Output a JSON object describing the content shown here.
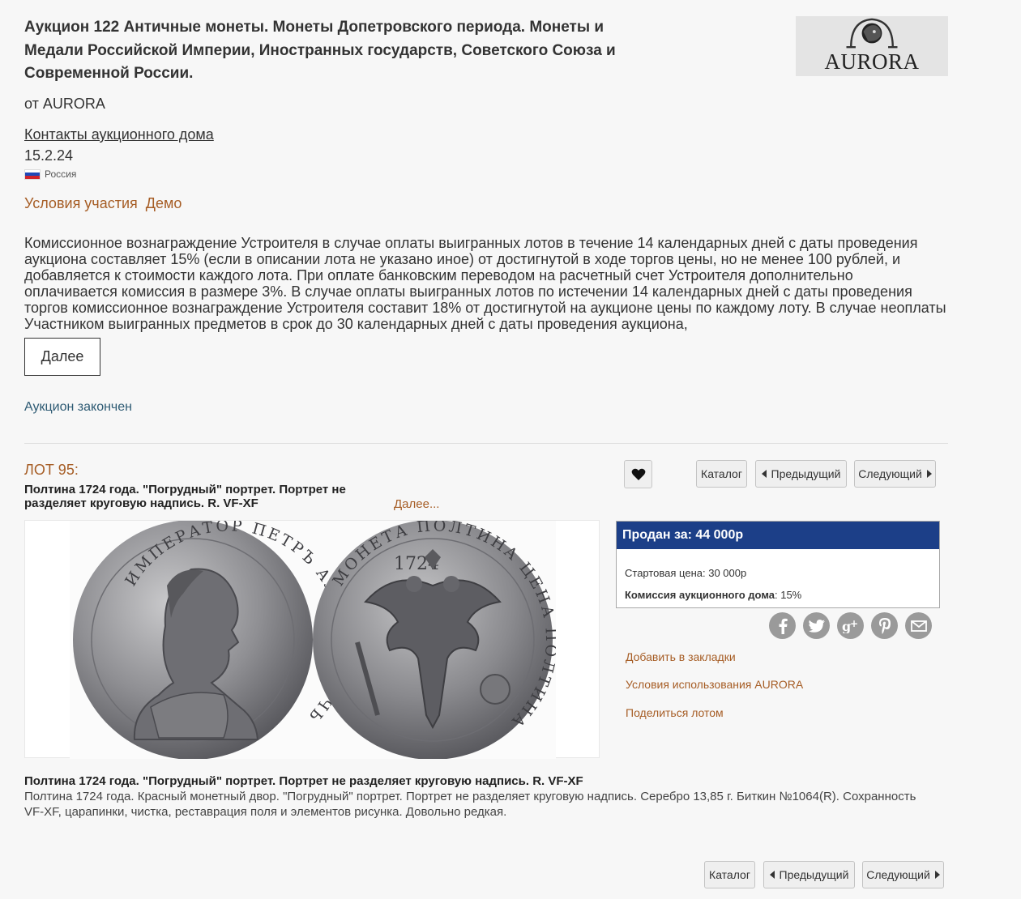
{
  "header": {
    "title": "Аукцион 122 Античные монеты. Монеты Допетровского периода. Монеты и Медали Российской Империи, Иностранных государств, Советского Союза и Современной России.",
    "from": "от AURORA",
    "contacts_link": "Контакты аукционного дома",
    "date": "15.2.24",
    "country": "Россия",
    "logo_text": "AURORA",
    "terms_link": "Условия участия",
    "demo_link": "Демо"
  },
  "terms": {
    "text": "Комиссионное вознаграждение Устроителя в случае оплаты выигранных лотов в течение 14 календарных дней с даты проведения аукциона составляет 15% (если в описании лота не указано иное) от достигнутой в ходе торгов цены, но не менее 100 рублей, и добавляется к стоимости каждого лота. При оплате банковским переводом на расчетный счет Устроителя дополнительно оплачивается комиссия в размере 3%. В случае оплаты выигранных лотов по истечении 14 календарных дней с даты проведения торгов комиссионное вознаграждение Устроителя составит 18% от достигнутой на аукционе цены по каждому лоту. В случае неоплаты Участником выигранных предметов в срок до 30 календарных дней с даты проведения аукциона,",
    "more_button": "Далее",
    "status": "Аукцион закончен"
  },
  "lot": {
    "number": "ЛОТ 95:",
    "short_title": "Полтина 1724 года. \"Погрудный\" портрет. Портрет не разделяет круговую надпись. R. VF-XF",
    "more_link": "Далее...",
    "nav": {
      "catalog": "Каталог",
      "prev": "Предыдущий",
      "next": "Следующий"
    },
    "sold_label": "Продан за: 44 000р",
    "start_price_label": "Стартовая цена:",
    "start_price_value": "30 000р",
    "commission_label": "Комиссия аукционного дома",
    "commission_value": ": 15%",
    "side_links": {
      "bookmark": "Добавить в закладки",
      "terms": "Условия использования AURORA",
      "share": "Поделиться лотом"
    },
    "social_icons": [
      "facebook-icon",
      "twitter-icon",
      "google-plus-icon",
      "pinterest-icon",
      "mail-icon"
    ],
    "description_title": "Полтина 1724 года. \"Погрудный\" портрет. Портрет не разделяет круговую надпись. R. VF-XF",
    "description_body": "Полтина 1724 года. Красный монетный двор. \"Погрудный\" портрет. Портрет не разделяет круговую надпись. Серебро 13,85 г. Биткин №1064(R). Сохранность VF-XF, царапинки, чистка, реставрация поля и элементов рисунка. Довольно редкая.",
    "coin_obverse_legend": "ИМПЕРАТОР ПЕТРЪ АЛЕКСИЕВИЧЬ",
    "coin_reverse_year": "1724",
    "coin_reverse_legend": "МОНЕТА ПОЛТИНА ЦЕНА ПОЛТИНА"
  },
  "colors": {
    "accent_link": "#a65d25",
    "sold_header": "#1c3f88",
    "status_text": "#2d5a73",
    "background": "#f7f7f7"
  }
}
